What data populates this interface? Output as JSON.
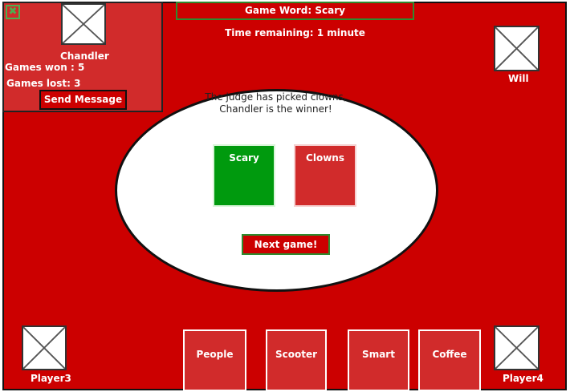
{
  "header": {
    "game_word": "Game Word: Scary",
    "time_remaining": "Time remaining: 1 minute"
  },
  "player_panel": {
    "close_glyph": "✖",
    "name": "Chandler",
    "games_won": "Games won : 5",
    "games_lost": "Games lost: 3",
    "send_message_label": "Send Message"
  },
  "opponents": {
    "top_right": "Will",
    "bottom_left": "Player3",
    "bottom_right": "Player4"
  },
  "round": {
    "result_line1": "The judge has picked clowns,",
    "result_line2": "Chandler is the winner!",
    "green_card": "Scary",
    "red_card": "Clowns",
    "next_game_label": "Next game!"
  },
  "hand": {
    "cards": [
      "People",
      "Scooter",
      "Smart",
      "Coffee"
    ]
  },
  "colors": {
    "table": "#cc0000",
    "card_red": "#d12b2b",
    "card_green": "#009a0e",
    "accent_green_border": "#2e8b2e"
  },
  "icons": {
    "avatar_placeholder": "image-placeholder-icon",
    "close": "close-icon"
  }
}
